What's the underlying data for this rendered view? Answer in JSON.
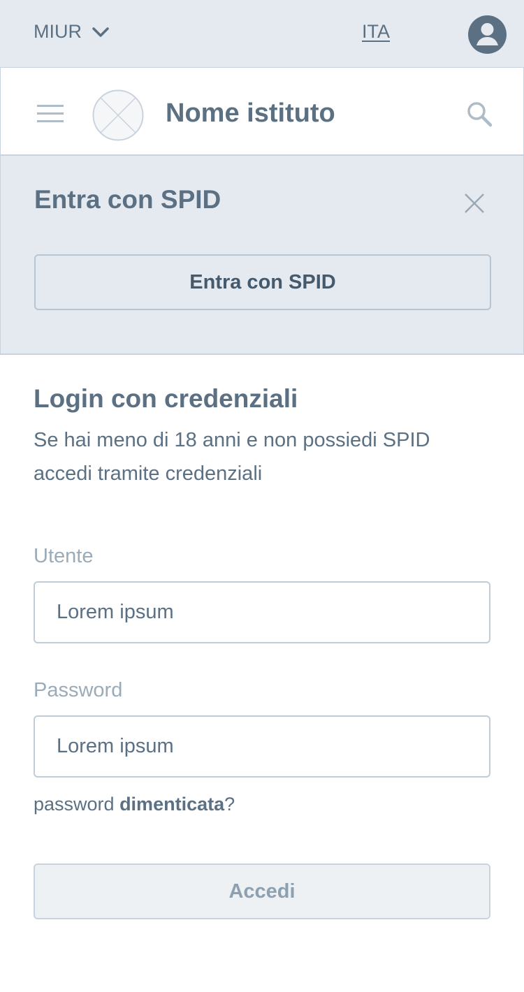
{
  "topbar": {
    "org_label": "MIUR",
    "org_icon": "chevron-down-icon",
    "language": "ITA",
    "user_icon": "user-avatar-icon"
  },
  "header": {
    "menu_icon": "hamburger-menu-icon",
    "logo_icon": "placeholder-logo-icon",
    "institute_name": "Nome istituto",
    "search_icon": "search-icon"
  },
  "spid": {
    "title": "Entra con SPID",
    "button_label": "Entra con SPID",
    "close_icon": "close-icon"
  },
  "login": {
    "title": "Login con credenziali",
    "subtitle": "Se hai meno di 18 anni e non possiedi SPID accedi tramite credenziali",
    "user_label": "Utente",
    "user_placeholder": "Lorem ipsum",
    "password_label": "Password",
    "password_placeholder": "Lorem ipsum",
    "forgot_prefix": "password ",
    "forgot_link": "dimenticata",
    "forgot_suffix": "?",
    "submit_label": "Accedi"
  },
  "colors": {
    "primary_text": "#5b7083",
    "panel_bg": "#e5e9f0",
    "border": "#c9d3dd",
    "muted_label": "#9aabb9"
  }
}
